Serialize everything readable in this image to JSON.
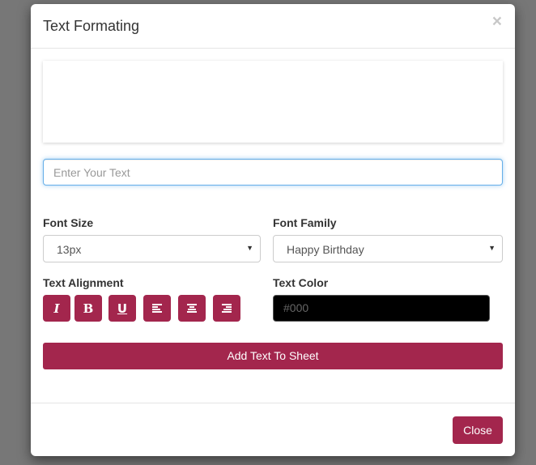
{
  "modal": {
    "title": "Text Formating",
    "close_icon": "close-icon"
  },
  "text_input": {
    "placeholder": "Enter Your Text",
    "value": ""
  },
  "font_size": {
    "label": "Font Size",
    "selected": "13px"
  },
  "font_family": {
    "label": "Font Family",
    "selected": "Happy Birthday"
  },
  "alignment": {
    "label": "Text Alignment",
    "buttons": [
      {
        "name": "italic",
        "glyph": "I",
        "icon": "italic-icon"
      },
      {
        "name": "bold",
        "glyph": "B",
        "icon": "bold-icon"
      },
      {
        "name": "underline",
        "glyph": "U",
        "icon": "underline-icon"
      },
      {
        "name": "align-left",
        "icon": "align-left-icon"
      },
      {
        "name": "align-center",
        "icon": "align-center-icon"
      },
      {
        "name": "align-right",
        "icon": "align-right-icon"
      }
    ]
  },
  "text_color": {
    "label": "Text Color",
    "value": "#000",
    "swatch": "#000000"
  },
  "actions": {
    "add_label": "Add Text To Sheet",
    "close_label": "Close"
  },
  "colors": {
    "accent": "#a3264d",
    "backdrop": "#777777"
  }
}
